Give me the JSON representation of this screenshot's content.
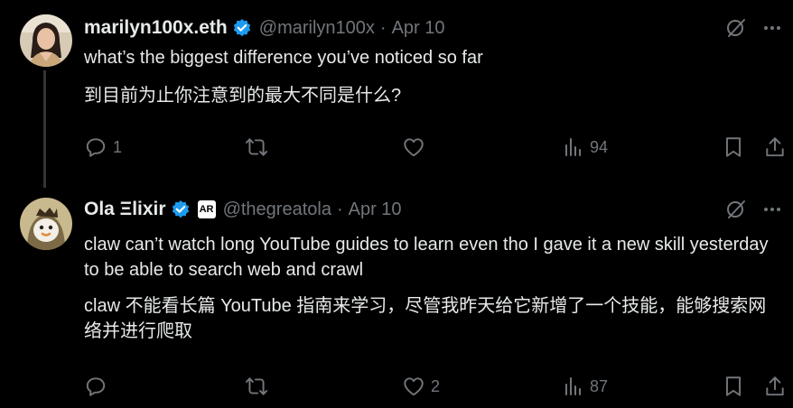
{
  "tweets": [
    {
      "name": "marilyn100x.eth",
      "handle": "@marilyn100x",
      "separator": "·",
      "date": "Apr 10",
      "text_en": "what’s the biggest difference you’ve noticed so far",
      "text_zh": "到目前为止你注意到的最大不同是什么?",
      "replies": "1",
      "retweets": "",
      "likes": "",
      "views": "94",
      "icons": [
        "verified-badge",
        "grok-icon",
        "more-icon",
        "reply-icon",
        "retweet-icon",
        "like-icon",
        "views-icon",
        "bookmark-icon",
        "share-icon"
      ]
    },
    {
      "name": "Ola Ξlixir",
      "handle": "@thegreatola",
      "separator": "·",
      "date": "Apr 10",
      "org_badge": "AR",
      "text_en": "claw can’t watch long YouTube guides to learn even tho I gave it a new skill yesterday to be able to search web and crawl",
      "text_zh": "claw 不能看长篇 YouTube 指南来学习，尽管我昨天给它新增了一个技能，能够搜索网络并进行爬取",
      "replies": "",
      "retweets": "",
      "likes": "2",
      "views": "87",
      "icons": [
        "verified-badge",
        "affiliate-badge",
        "grok-icon",
        "more-icon",
        "reply-icon",
        "retweet-icon",
        "like-icon",
        "views-icon",
        "bookmark-icon",
        "share-icon"
      ]
    }
  ],
  "colors": {
    "background": "#000000",
    "text": "#e7e9ea",
    "muted": "#71767b",
    "verified": "#1d9bf0",
    "thread_line": "#333639"
  }
}
